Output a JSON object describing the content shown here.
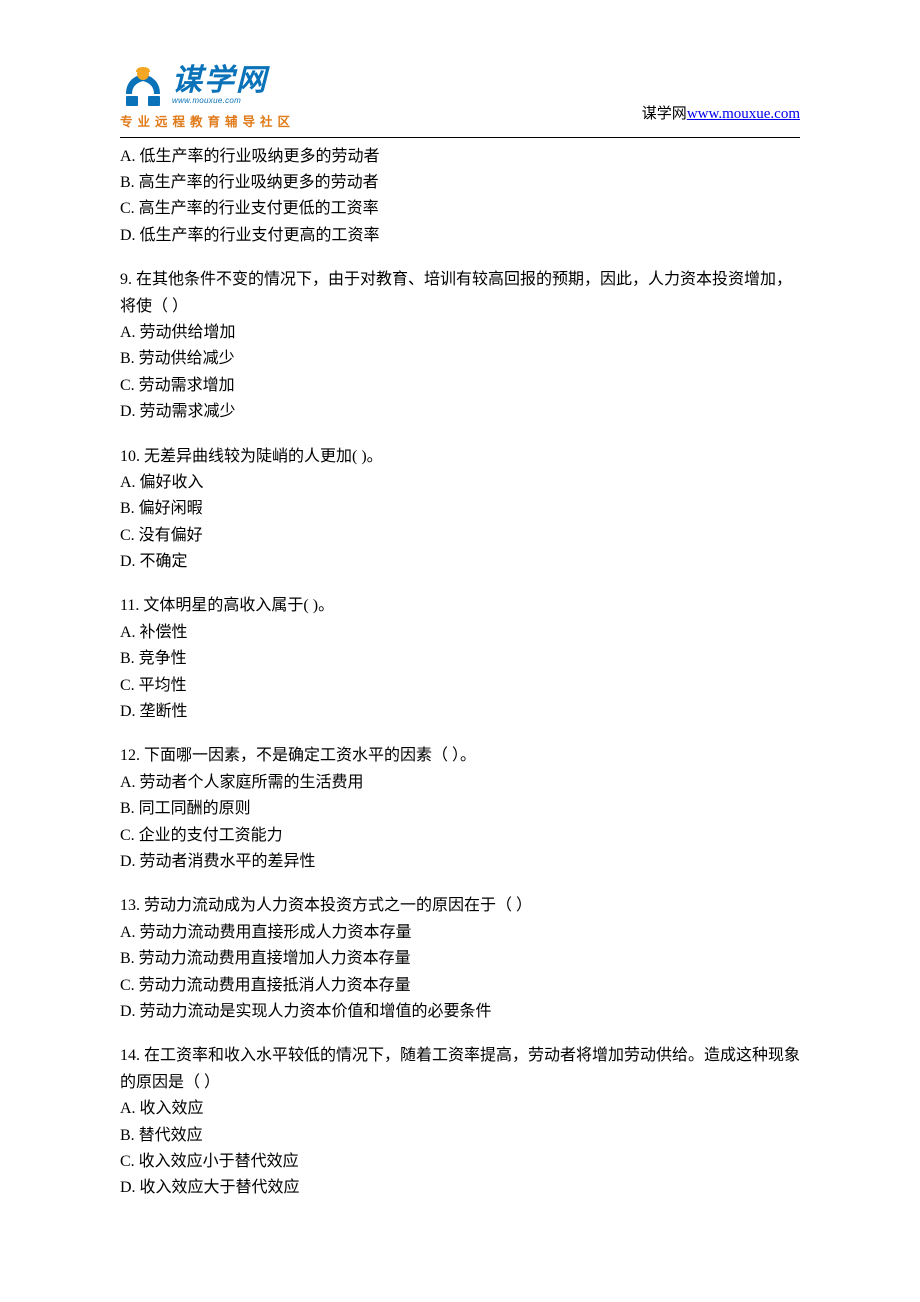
{
  "header": {
    "logo_main": "谋学网",
    "logo_url": "www.mouxue.com",
    "logo_tagline": "专业远程教育辅导社区",
    "right_text_prefix": "谋学网",
    "right_link_text": "www.mouxue.com"
  },
  "partial_options": {
    "A": "A. 低生产率的行业吸纳更多的劳动者",
    "B": "B. 高生产率的行业吸纳更多的劳动者",
    "C": "C. 高生产率的行业支付更低的工资率",
    "D": "D. 低生产率的行业支付更高的工资率"
  },
  "questions": [
    {
      "num": "9.",
      "stem": "9.  在其他条件不变的情况下，由于对教育、培训有较高回报的预期，因此，人力资本投资增加，将使（ ）",
      "A": "A. 劳动供给增加",
      "B": "B. 劳动供给减少",
      "C": "C. 劳动需求增加",
      "D": "D. 劳动需求减少"
    },
    {
      "num": "10.",
      "stem": "10.  无差异曲线较为陡峭的人更加( )。",
      "A": "A. 偏好收入",
      "B": "B. 偏好闲暇",
      "C": "C. 没有偏好",
      "D": "D. 不确定"
    },
    {
      "num": "11.",
      "stem": "11.  文体明星的高收入属于( )。",
      "A": "A. 补偿性",
      "B": "B. 竞争性",
      "C": "C. 平均性",
      "D": "D. 垄断性"
    },
    {
      "num": "12.",
      "stem": "12.  下面哪一因素，不是确定工资水平的因素（ ）。",
      "A": "A. 劳动者个人家庭所需的生活费用",
      "B": "B. 同工同酬的原则",
      "C": "C. 企业的支付工资能力",
      "D": "D. 劳动者消费水平的差异性"
    },
    {
      "num": "13.",
      "stem": "13.  劳动力流动成为人力资本投资方式之一的原因在于（ ）",
      "A": "A. 劳动力流动费用直接形成人力资本存量",
      "B": "B. 劳动力流动费用直接增加人力资本存量",
      "C": "C. 劳动力流动费用直接抵消人力资本存量",
      "D": "D. 劳动力流动是实现人力资本价值和增值的必要条件"
    },
    {
      "num": "14.",
      "stem": "14.  在工资率和收入水平较低的情况下，随着工资率提高，劳动者将增加劳动供给。造成这种现象的原因是（ ）",
      "A": "A. 收入效应",
      "B": "B. 替代效应",
      "C": "C. 收入效应小于替代效应",
      "D": "D. 收入效应大于替代效应"
    }
  ]
}
